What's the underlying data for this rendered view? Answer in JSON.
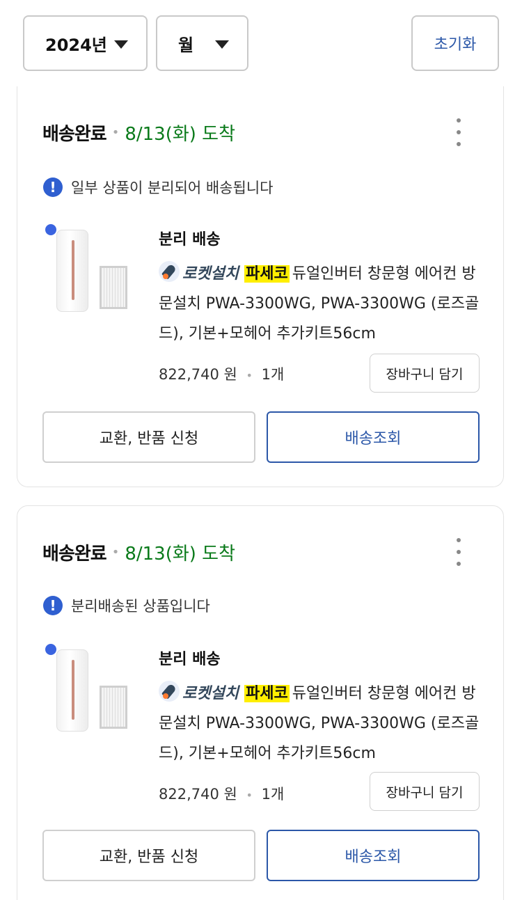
{
  "filters": {
    "year_label": "2024년",
    "month_label": "월",
    "reset_label": "초기화"
  },
  "orders": [
    {
      "status": "배송완료",
      "arrival": "8/13(화) 도착",
      "notice": "일부 상품이 분리되어 배송됩니다",
      "separate_title": "분리 배송",
      "badge_text": "로켓설치",
      "brand": "파세코",
      "product_name": "듀얼인버터 창문형 에어컨 방문설치 PWA-3300WG, PWA-3300WG (로즈골드), 기본+모헤어 추가키트56cm",
      "price": "822,740 원",
      "quantity": "1개",
      "cart_button": "장바구니 담기",
      "exchange_button": "교환, 반품 신청",
      "track_button": "배송조회"
    },
    {
      "status": "배송완료",
      "arrival": "8/13(화) 도착",
      "notice": "분리배송된 상품입니다",
      "separate_title": "분리 배송",
      "badge_text": "로켓설치",
      "brand": "파세코",
      "product_name": "듀얼인버터 창문형 에어컨 방문설치 PWA-3300WG, PWA-3300WG (로즈골드), 기본+모헤어 추가키트56cm",
      "price": "822,740 원",
      "quantity": "1개",
      "cart_button": "장바구니 담기",
      "exchange_button": "교환, 반품 신청",
      "track_button": "배송조회"
    }
  ],
  "colors": {
    "accent": "#2b57a8",
    "arrival_green": "#0a7a1a",
    "brand_highlight": "#ffef00"
  }
}
